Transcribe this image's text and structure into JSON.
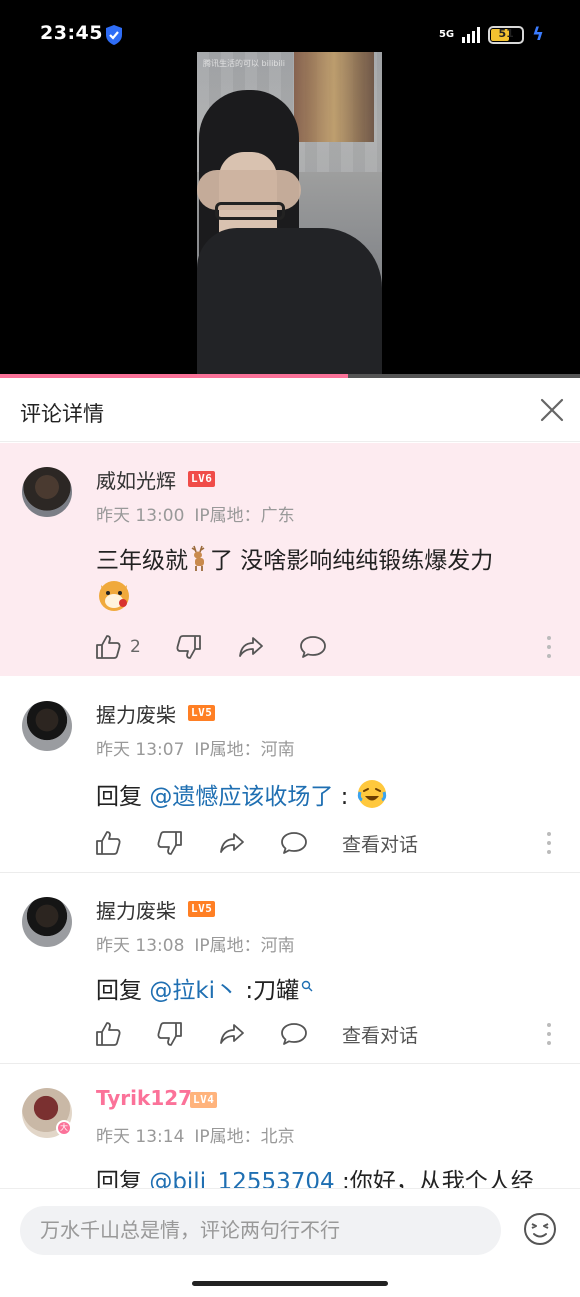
{
  "status": {
    "time": "23:45",
    "network": "5G",
    "battery": "51"
  },
  "video": {
    "watermark": "腾讯生活的可以 bilibili",
    "progress": 0.6
  },
  "panel": {
    "title": "评论详情"
  },
  "comments": [
    {
      "username": "威如光辉",
      "level": "LV6",
      "time": "昨天 13:00",
      "ip": "IP属地：广东",
      "text_before": "三年级就",
      "text_after": "了 没啥影响纯纯锻练爆发力",
      "likes": "2"
    },
    {
      "username": "握力废柴",
      "level": "LV5",
      "time": "昨天 13:07",
      "ip": "IP属地：河南",
      "reply_prefix": "回复 ",
      "mention": "@遗憾应该收场了",
      "text": " :",
      "view_convo": "查看对话"
    },
    {
      "username": "握力废柴",
      "level": "LV5",
      "time": "昨天 13:08",
      "ip": "IP属地：河南",
      "reply_prefix": "回复 ",
      "mention": "@拉ki丶",
      "text": " :刀罐",
      "view_convo": "查看对话"
    },
    {
      "username": "Tyrik127",
      "level": "LV4",
      "time": "昨天 13:14",
      "ip": "IP属地：北京",
      "reply_prefix": "回复 ",
      "mention": "@bili_12553704",
      "text": " :你好，从我个人经"
    }
  ],
  "input": {
    "placeholder": "万水千山总是情，评论两句行不行"
  },
  "colors": {
    "accent_pink": "#fb7299",
    "mention_blue": "#1f6fb2",
    "lv6": "#f04c49",
    "lv5": "#ff7f24",
    "lv4": "#ffb37c",
    "highlight_bg": "#fdebf0"
  }
}
